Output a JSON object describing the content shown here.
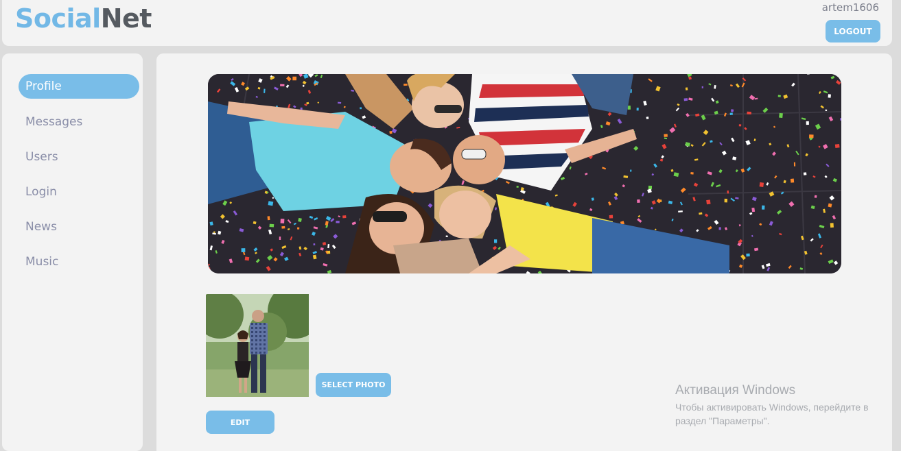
{
  "header": {
    "logo_part1": "Social",
    "logo_part2": "Net",
    "username": "artem1606",
    "logout_label": "LOGOUT"
  },
  "sidebar": {
    "items": [
      {
        "label": "Profile",
        "active": true
      },
      {
        "label": "Messages"
      },
      {
        "label": "Users"
      },
      {
        "label": "Login"
      },
      {
        "label": "News"
      },
      {
        "label": "Music"
      }
    ]
  },
  "profile": {
    "select_photo_label": "SELECT PHOTO",
    "edit_label": "EDIT"
  },
  "watermark": {
    "title": "Активация Windows",
    "text": "Чтобы активировать Windows, перейдите в раздел \"Параметры\"."
  },
  "colors": {
    "accent": "#79bde8",
    "logo_blue": "#72b8e6",
    "logo_gray": "#555a60",
    "panel": "#f3f3f3",
    "background": "#dcdcdc",
    "nav_text": "#8a8ea8"
  }
}
